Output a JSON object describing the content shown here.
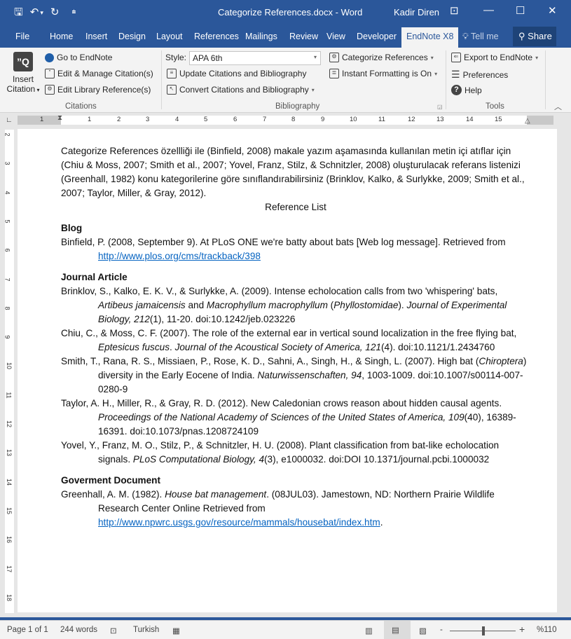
{
  "window": {
    "title": "Categorize References.docx  -  Word",
    "user": "Kadir Diren",
    "controls": {
      "ribbon_display": "⊡",
      "minimize": "—",
      "maximize": "☐",
      "close": "✕"
    }
  },
  "qat": {
    "save": "🖫",
    "undo": "↶",
    "undo_dropdown": "▾",
    "redo": "↻",
    "customize": "⩧"
  },
  "tabs": [
    "File",
    "Home",
    "Insert",
    "Design",
    "Layout",
    "References",
    "Mailings",
    "Review",
    "View",
    "Developer",
    "EndNote X8"
  ],
  "active_tab": "EndNote X8",
  "tell_me": "Tell me",
  "share": "Share",
  "ribbon": {
    "citations": {
      "label": "Citations",
      "insert_citation": "Insert",
      "insert_citation_2": "Citation",
      "go_to_endnote": "Go to EndNote",
      "edit_manage": "Edit & Manage Citation(s)",
      "edit_library": "Edit Library Reference(s)"
    },
    "bibliography": {
      "label": "Bibliography",
      "style_label": "Style:",
      "style_value": "APA 6th",
      "update": "Update Citations and Bibliography",
      "convert": "Convert Citations and Bibliography",
      "categorize": "Categorize References",
      "instant_formatting": "Instant Formatting is On"
    },
    "tools": {
      "label": "Tools",
      "export": "Export to EndNote",
      "preferences": "Preferences",
      "help": "Help"
    }
  },
  "ruler": {
    "h_numbers": [
      "1",
      "1",
      "2",
      "3",
      "4",
      "5",
      "6",
      "7",
      "8",
      "9",
      "10",
      "11",
      "12",
      "13",
      "14",
      "15"
    ],
    "v_numbers": [
      "2",
      "3",
      "4",
      "5",
      "6",
      "7",
      "8",
      "9",
      "10",
      "11",
      "12",
      "13",
      "14",
      "15",
      "16",
      "17",
      "18"
    ]
  },
  "document": {
    "intro": "Categorize References özellliği ile (Binfield, 2008) makale yazım aşamasında kullanılan metin içi atıflar için (Chiu & Moss, 2007; Smith et al., 2007; Yovel, Franz, Stilz, & Schnitzler, 2008) oluşturulacak referans listenizi (Greenhall, 1982) konu kategorilerine göre sınıflandırabilirsiniz (Brinklov, Kalko, & Surlykke, 2009; Smith et al., 2007; Taylor, Miller, & Gray, 2012).",
    "reference_list_title": "Reference List",
    "categories": [
      {
        "name": "Blog",
        "refs": [
          {
            "parts": [
              {
                "t": "Binfield, P. (2008, September 9). At PLoS ONE we're batty about bats [Web log message].  Retrieved from "
              },
              {
                "t": "http://www.plos.org/cms/trackback/398",
                "link": true
              }
            ]
          }
        ]
      },
      {
        "name": "Journal Article",
        "refs": [
          {
            "parts": [
              {
                "t": "Brinklov, S., Kalko, E. K. V., & Surlykke, A. (2009). Intense echolocation calls from two 'whispering' bats, "
              },
              {
                "t": "Artibeus jamaicensis",
                "i": true
              },
              {
                "t": " and "
              },
              {
                "t": "Macrophyllum macrophyllum",
                "i": true
              },
              {
                "t": " ("
              },
              {
                "t": "Phyllostomidae",
                "i": true
              },
              {
                "t": "). "
              },
              {
                "t": "Journal of Experimental Biology, 212",
                "i": true
              },
              {
                "t": "(1), 11-20. doi:10.1242/jeb.023226"
              }
            ]
          },
          {
            "parts": [
              {
                "t": "Chiu, C., & Moss, C. F. (2007). The role of the external ear in vertical sound localization in the free flying bat, "
              },
              {
                "t": "Eptesicus fuscus",
                "i": true
              },
              {
                "t": ". "
              },
              {
                "t": "Journal of the Acoustical Society of America, 121",
                "i": true
              },
              {
                "t": "(4). doi:10.1121/1.2434760"
              }
            ]
          },
          {
            "parts": [
              {
                "t": "Smith, T., Rana, R. S., Missiaen, P., Rose, K. D., Sahni, A., Singh, H., & Singh, L. (2007). High bat ("
              },
              {
                "t": "Chiroptera",
                "i": true
              },
              {
                "t": ") diversity in the Early Eocene of India. "
              },
              {
                "t": "Naturwissenschaften, 94",
                "i": true
              },
              {
                "t": ", 1003-1009. doi:10.1007/s00114-007-0280-9"
              }
            ]
          },
          {
            "parts": [
              {
                "t": "Taylor, A. H., Miller, R., & Gray, R. D. (2012). New Caledonian crows reason about hidden causal agents. "
              },
              {
                "t": "Proceedings of the National Academy of Sciences of the United States of America, 109",
                "i": true
              },
              {
                "t": "(40), 16389-16391. doi:10.1073/pnas.1208724109"
              }
            ]
          },
          {
            "parts": [
              {
                "t": "Yovel, Y., Franz, M. O., Stilz, P., & Schnitzler, H. U. (2008). Plant classification from bat-like echolocation signals. "
              },
              {
                "t": "PLoS Computational Biology, 4",
                "i": true
              },
              {
                "t": "(3), e1000032. doi:DOI 10.1371/journal.pcbi.1000032"
              }
            ]
          }
        ]
      },
      {
        "name": "Goverment Document",
        "refs": [
          {
            "parts": [
              {
                "t": "Greenhall, A. M. (1982). "
              },
              {
                "t": "House bat management",
                "i": true
              },
              {
                "t": ". (08JUL03). Jamestown, ND: Northern Prairie Wildlife Research Center Online Retrieved from "
              },
              {
                "t": "http://www.npwrc.usgs.gov/resource/mammals/housebat/index.htm",
                "link": true
              },
              {
                "t": "."
              }
            ]
          }
        ]
      }
    ]
  },
  "status": {
    "page": "Page 1 of 1",
    "words": "244 words",
    "language": "Turkish",
    "zoom_label": "%110",
    "zoom_percent": 110,
    "zoom_minus": "-",
    "zoom_plus": "+"
  }
}
